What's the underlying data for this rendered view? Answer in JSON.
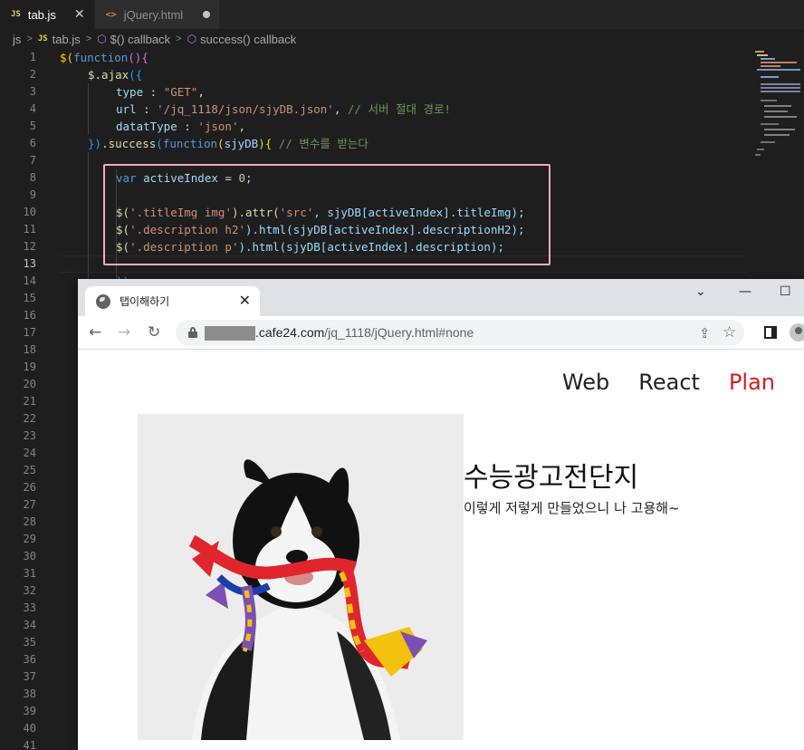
{
  "editor": {
    "tabs": [
      {
        "badge": "JS",
        "label": "tab.js",
        "close": "✕"
      },
      {
        "badge": "<>",
        "label": "jQuery.html"
      }
    ],
    "breadcrumb": [
      "js",
      "JS",
      "tab.js",
      "$() callback",
      "success() callback"
    ],
    "line_numbers": [
      "1",
      "2",
      "3",
      "4",
      "5",
      "6",
      "7",
      "8",
      "9",
      "10",
      "11",
      "12",
      "13",
      "14",
      "15",
      "16",
      "17",
      "18",
      "19",
      "20",
      "21",
      "22",
      "23",
      "24",
      "25",
      "26",
      "27",
      "28",
      "29",
      "30",
      "31",
      "32",
      "33",
      "34",
      "35",
      "36",
      "37",
      "38",
      "39",
      "40",
      "41"
    ],
    "code": {
      "l1": {
        "a": "$",
        "b": "(",
        "c": "function",
        "d": "(){"
      },
      "l2": {
        "a": "$",
        "b": ".ajax",
        "c": "({"
      },
      "l3": {
        "a": "type",
        "b": " : ",
        "c": "\"GET\"",
        "d": ","
      },
      "l4": {
        "a": "url",
        "b": " : ",
        "c": "'/jq_1118/json/sjyDB.json'",
        "d": ", ",
        "e": "// 서버 절대 경로!"
      },
      "l5": {
        "a": "datatType",
        "b": " : ",
        "c": "'json'",
        "d": ","
      },
      "l6": {
        "a": "})",
        "b": ".success",
        "c": "(",
        "d": "function",
        "e": "(",
        "f": "sjyDB",
        "g": "){",
        "h": " // 변수를 받는다"
      },
      "l8": {
        "a": "var",
        "b": " activeIndex",
        "c": " = ",
        "d": "0",
        "e": ";"
      },
      "l10": {
        "a": "$(",
        "b": "'.titleImg img'",
        "c": ").attr(",
        "d": "'src'",
        "e": ", sjyDB[",
        "f": "activeIndex",
        "g": "].titleImg);"
      },
      "l11": {
        "a": "$(",
        "b": "'.description h2'",
        "c": ").html(sjyDB[",
        "d": "activeIndex",
        "e": "].descriptionH2);"
      },
      "l12": {
        "a": "$(",
        "b": "'.description p'",
        "c": ").html(sjyDB[",
        "d": "activeIndex",
        "e": "].description);"
      },
      "l14": {
        "a": "})"
      }
    }
  },
  "browser": {
    "tab_title": "탭이해하기",
    "tab_close": "✕",
    "window_controls": {
      "chevron": "⌄",
      "minimize": "—",
      "maximize": "☐"
    },
    "nav": {
      "back": "←",
      "forward": "→",
      "reload": "↻"
    },
    "url_host": ".cafe24.com",
    "url_path": "/jq_1118/jQuery.html#none",
    "omnibox_icons": {
      "share": "⇪",
      "star": "☆"
    }
  },
  "page": {
    "menu": [
      "Web",
      "React",
      "Plan"
    ],
    "active_menu": "Plan",
    "description_h2": "수능광고전단지",
    "description_p": "이렇게 저렇게 만들었으니 나 고용해~"
  },
  "colors": {
    "editor_bg": "#1e1e1e",
    "highlight_box": "#f4a9c4",
    "menu_active": "#d81b1b"
  }
}
